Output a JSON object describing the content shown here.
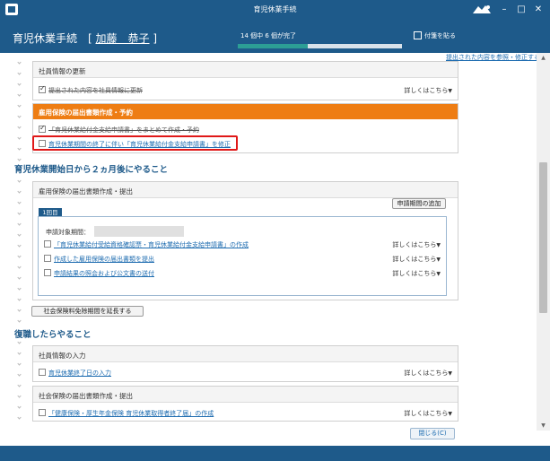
{
  "window": {
    "title": "育児休業手続"
  },
  "header": {
    "title": "育児休業手続",
    "name_bracket_open": "[",
    "name": "加藤　恭子",
    "name_bracket_close": "]",
    "progress_text": "14 個中 6 個が完了",
    "progress": {
      "done": 6,
      "total": 14
    },
    "note_label": "付箋を貼る"
  },
  "submitted_link": "提出された内容を参照・修正する",
  "sections": {
    "employee_update": {
      "title": "社員情報の更新",
      "item_label": "提出された内容を社員情報に更新",
      "item_more": "詳しくはこちら"
    },
    "employment_insurance": {
      "title": "雇用保険の届出書類作成・予約",
      "items": [
        "「育児休業給付金支給申請書」をまとめて作成・予約",
        "育児休業期間の終了に伴い「育児休業給付金支給申請書」を修正"
      ]
    }
  },
  "two_months": {
    "title": "育児休業開始日から２ヵ月後にやること",
    "card_title": "雇用保険の届出書類作成・提出",
    "add_period_button": "申請期間の追加",
    "period_tab": "1回目",
    "period_label": "申請対象期間：",
    "items": [
      {
        "label": "「育児休業給付受給資格確認票・育児休業給付金支給申請書」の作成",
        "more": "詳しくはこちら"
      },
      {
        "label": "作成した雇用保険の届出書類を提出",
        "more": "詳しくはこちら"
      },
      {
        "label": "申請結果の照会および公文書の送付",
        "more": "詳しくはこちら"
      }
    ],
    "extend_button": "社会保険料免除期間を延長する"
  },
  "return_work": {
    "title": "復職したらやること",
    "employee_input": {
      "title": "社員情報の入力",
      "item": "育児休業終了日の入力",
      "more": "詳しくはこちら"
    },
    "social_insurance": {
      "title": "社会保険の届出書類作成・提出",
      "item": "「健康保険・厚生年金保険 育児休業取得者終了届」の作成",
      "more": "詳しくはこちら"
    }
  },
  "close_button": "閉じる(C)",
  "colors": {
    "primary": "#1e5a8a",
    "accent_orange": "#ee7d13",
    "progress": "#2c9e95",
    "highlight": "#e01818",
    "link": "#1e6cb0"
  }
}
